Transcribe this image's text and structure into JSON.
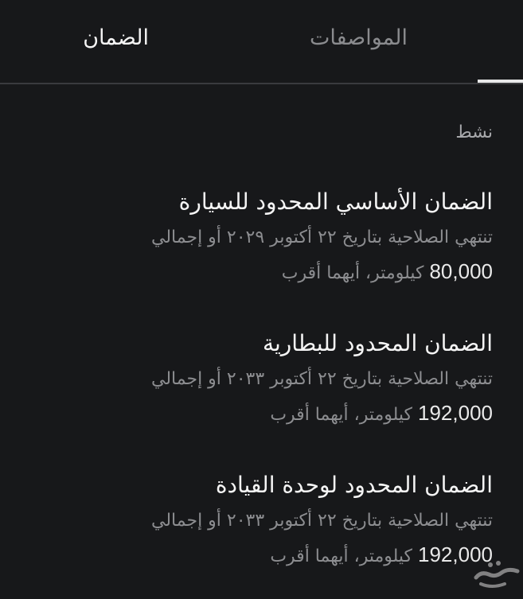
{
  "tabs": {
    "warranty": "الضمان",
    "specs": "المواصفات"
  },
  "status": "نشط",
  "items": [
    {
      "title": "الضمان الأساسي المحدود للسيارة",
      "desc_prefix": "تنتهي الصلاحية بتاريخ ٢٢ أكتوبر ٢٠٢٩ أو إجمالي",
      "km": "80,000",
      "desc_suffix": "كيلومتر، أيهما أقرب"
    },
    {
      "title": "الضمان المحدود للبطارية",
      "desc_prefix": "تنتهي الصلاحية بتاريخ ٢٢ أكتوبر ٢٠٣٣ أو إجمالي",
      "km": "192,000",
      "desc_suffix": "كيلومتر، أيهما أقرب"
    },
    {
      "title": "الضمان المحدود لوحدة القيادة",
      "desc_prefix": "تنتهي الصلاحية بتاريخ ٢٢ أكتوبر ٢٠٣٣ أو إجمالي",
      "km": "192,000",
      "desc_suffix": "كيلومتر، أيهما أقرب"
    }
  ],
  "watermark": {
    "icon": "haraj-logo-icon"
  }
}
